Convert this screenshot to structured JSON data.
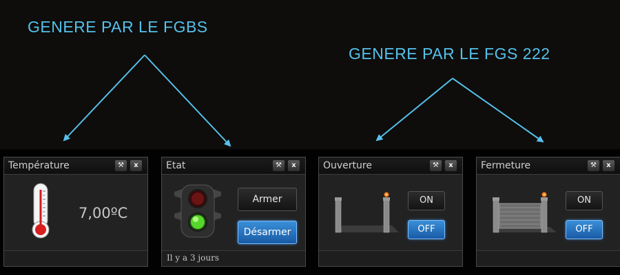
{
  "annotations": {
    "left": "GENERE PAR LE FGBS",
    "right": "GENERE PAR LE FGS 222"
  },
  "colors": {
    "annotation": "#56c1ec",
    "widget_bg": "#222222",
    "button_active": "#2a75c4"
  },
  "widgets": {
    "temperature": {
      "title": "Température",
      "value": "7,00ºC",
      "icon": "thermometer-icon"
    },
    "etat": {
      "title": "Etat",
      "arm_label": "Armer",
      "disarm_label": "Désarmer",
      "active": "Désarmer",
      "footer": "Il y a 3 jours",
      "icon": "traffic-light-icon"
    },
    "ouverture": {
      "title": "Ouverture",
      "on_label": "ON",
      "off_label": "OFF",
      "active": "OFF",
      "icon": "gate-open-icon"
    },
    "fermeture": {
      "title": "Fermeture",
      "on_label": "ON",
      "off_label": "OFF",
      "active": "OFF",
      "icon": "gate-closed-icon"
    }
  },
  "header_icons": {
    "settings": "wrench-icon",
    "close": "close-icon",
    "close_glyph": "x"
  }
}
